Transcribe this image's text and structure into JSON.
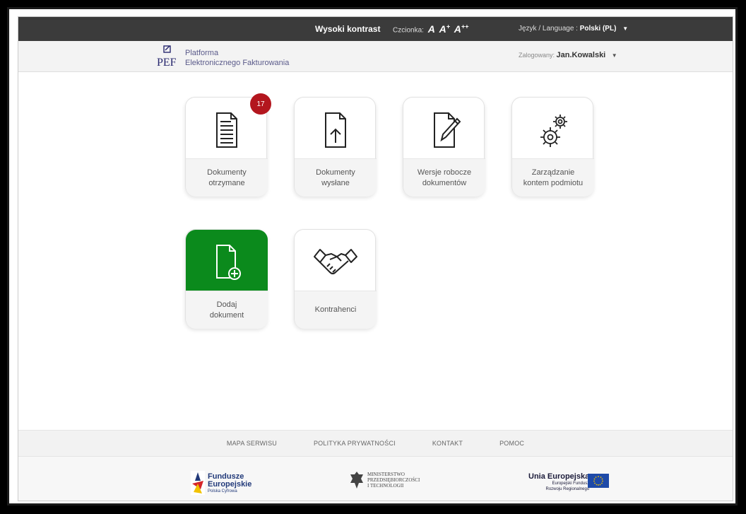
{
  "topbar": {
    "contrast_label": "Wysoki kontrast",
    "font_label": "Czcionka:",
    "font_a1": "A",
    "font_a2": "A",
    "font_a2_sup": "+",
    "font_a3": "A",
    "font_a3_sup": "++",
    "lang_label": "Język / Language :",
    "lang_value": "Polski (PL)"
  },
  "header": {
    "logo_text": "PEF",
    "title_line1": "Platforma",
    "title_line2": "Elektronicznego Fakturowania",
    "logged_label": "Zalogowany:",
    "user_name": "Jan.Kowalski"
  },
  "tiles": [
    {
      "line1": "Dokumenty",
      "line2": "otrzymane",
      "badge": "17"
    },
    {
      "line1": "Dokumenty",
      "line2": "wysłane"
    },
    {
      "line1": "Wersje robocze",
      "line2": "dokumentów"
    },
    {
      "line1": "Zarządzanie",
      "line2": "kontem podmiotu"
    },
    {
      "line1": "Dodaj",
      "line2": "dokument"
    },
    {
      "line1": "Kontrahenci",
      "line2": ""
    }
  ],
  "footer": {
    "links": [
      "MAPA SERWISU",
      "POLITYKA PRYWATNOŚCI",
      "KONTAKT",
      "POMOC"
    ]
  },
  "funders": {
    "fe_line1": "Fundusze",
    "fe_line2": "Europejskie",
    "fe_line3": "Polska Cyfrowa",
    "min_line1": "MINISTERSTWO",
    "min_line2": "PRZEDSIĘBIORCZOŚCI",
    "min_line3": "I TECHNOLOGII",
    "ue_line1": "Unia Europejska",
    "ue_line2": "Europejski Fundusz",
    "ue_line3": "Rozwoju Regionalnego"
  },
  "colors": {
    "topbar": "#3b3b3b",
    "green_tile": "#0b8a1c",
    "badge": "#b3161e",
    "eu_flag": "#1e4aa8"
  }
}
